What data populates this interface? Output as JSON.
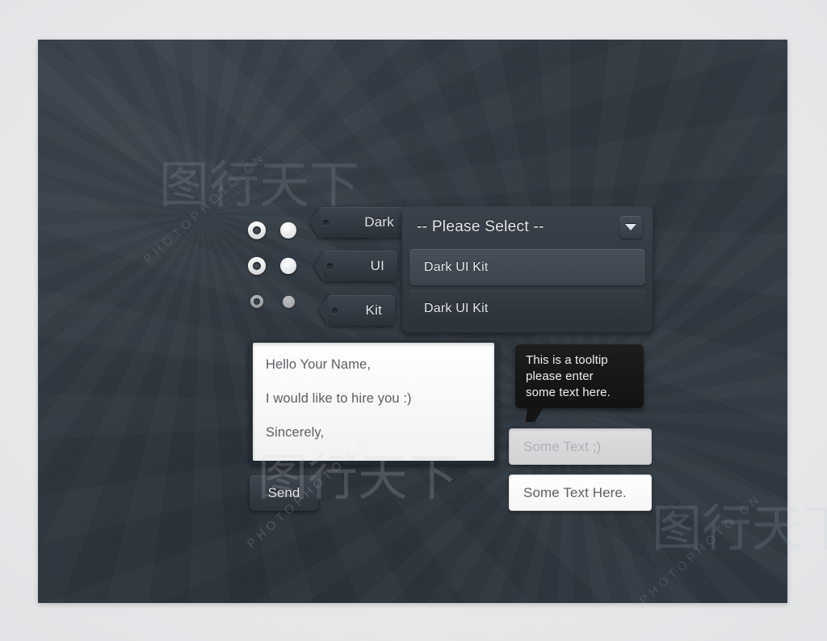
{
  "theme": {
    "backdrop_color": "#e9eaec",
    "panel_color": "#333b45",
    "accent_text_color": "#e6e9ec",
    "light_field_color": "#ffffff",
    "tooltip_color": "#151515"
  },
  "toggles": {
    "rows": [
      {
        "radio": "radio-selected",
        "check": "dot-filled"
      },
      {
        "radio": "radio-selected",
        "check": "dot-filled"
      },
      {
        "radio": "radio-disabled",
        "check": "dot-disabled"
      }
    ]
  },
  "tags": [
    {
      "label": "Dark",
      "icon": "tag-hole-icon"
    },
    {
      "label": "UI",
      "icon": "tag-hole-icon"
    },
    {
      "label": "Kit",
      "icon": "tag-hole-icon"
    }
  ],
  "select": {
    "selected_label": "-- Please Select --",
    "arrow_icon": "chevron-down-icon",
    "options": [
      {
        "label": "Dark UI Kit",
        "highlighted": true
      },
      {
        "label": "Dark UI Kit",
        "highlighted": false
      }
    ]
  },
  "textarea": {
    "lines": [
      "Hello Your Name,",
      "I would like to hire you :)",
      "Sincerely,"
    ]
  },
  "send_button": {
    "label": "Send"
  },
  "tooltip": {
    "text": "This is a tooltip\nplease enter\nsome text here."
  },
  "inputs": [
    {
      "name": "placeholder-input",
      "value": "",
      "placeholder": "Some Text ;)",
      "state": "empty"
    },
    {
      "name": "filled-input",
      "value": "Some Text Here.",
      "placeholder": "",
      "state": "filled"
    }
  ],
  "watermarks": {
    "text": "PHOTOPHOTO.CN",
    "glyph": "图行天下"
  }
}
